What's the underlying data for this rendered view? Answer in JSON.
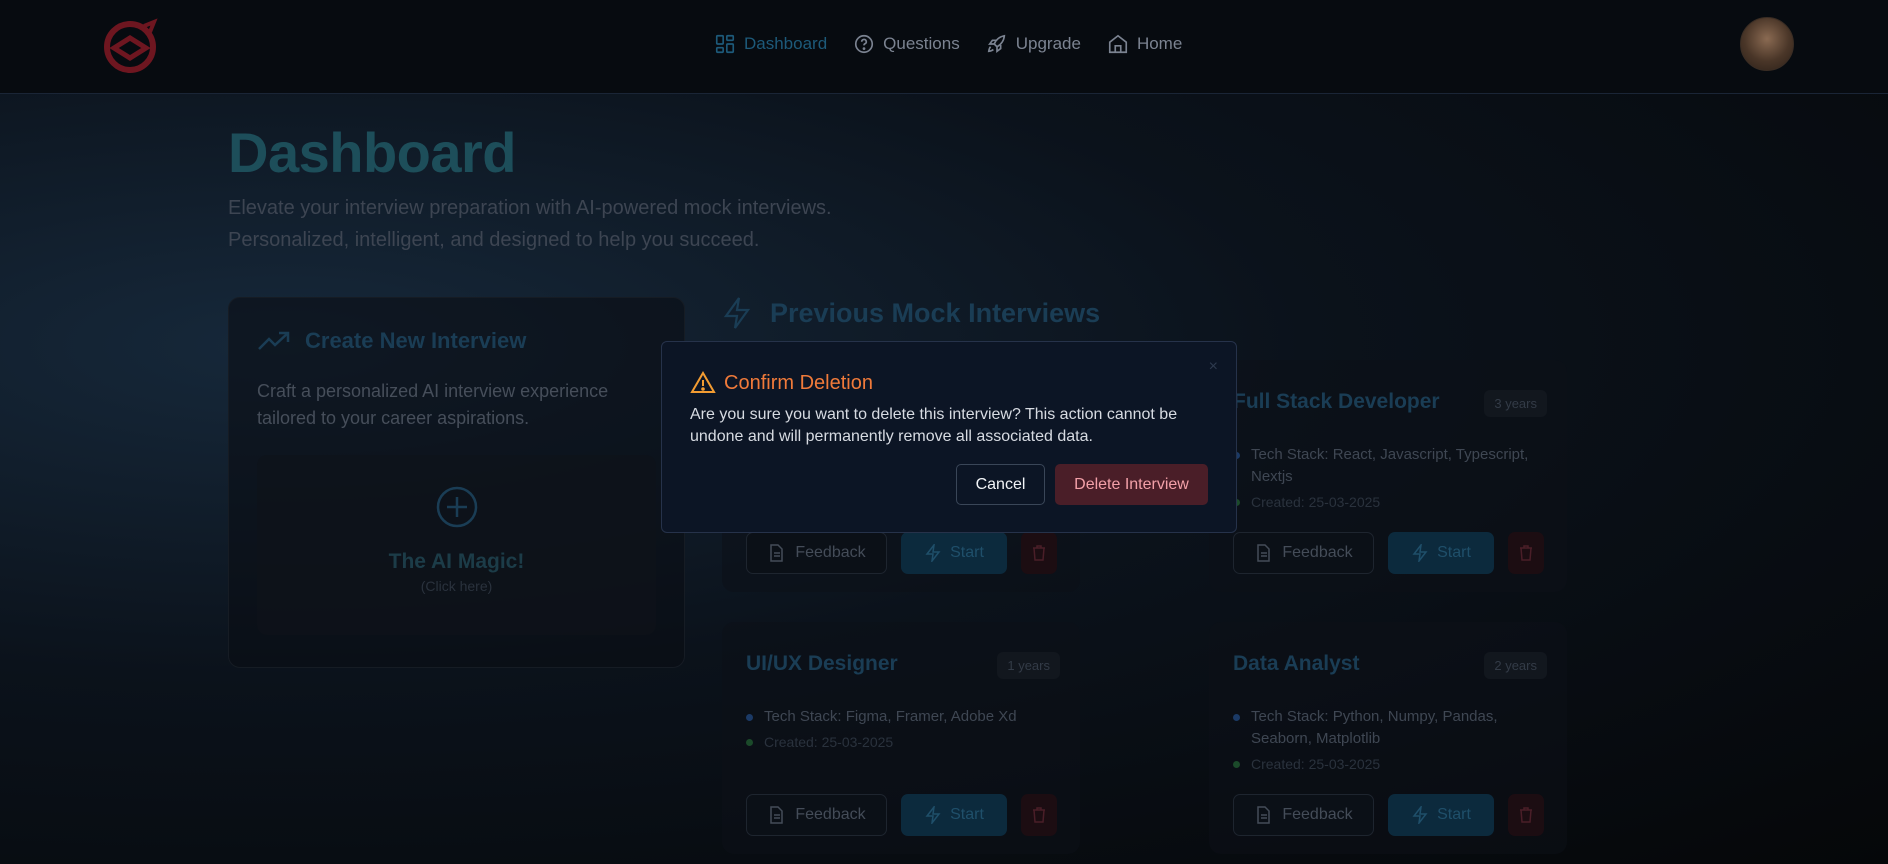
{
  "nav": {
    "links": [
      {
        "label": "Dashboard",
        "icon": "grid-icon",
        "active": true
      },
      {
        "label": "Questions",
        "icon": "question-circle-icon",
        "active": false
      },
      {
        "label": "Upgrade",
        "icon": "rocket-icon",
        "active": false
      },
      {
        "label": "Home",
        "icon": "home-icon",
        "active": false
      }
    ]
  },
  "header": {
    "title": "Dashboard",
    "subtitle_line1": "Elevate your interview preparation with AI-powered mock interviews.",
    "subtitle_line2": "Personalized, intelligent, and designed to help you succeed."
  },
  "create": {
    "title": "Create New Interview",
    "description": "Craft a personalized AI interview experience tailored to your career aspirations.",
    "magic_title": "The AI Magic!",
    "magic_sub": "(Click here)"
  },
  "previous": {
    "title": "Previous Mock Interviews",
    "cards": [
      {
        "title": "",
        "badge": "",
        "stack": "",
        "created": ""
      },
      {
        "title": "Full Stack Developer",
        "badge": "3 years",
        "stack": "Tech Stack: React, Javascript, Typescript, Nextjs",
        "created": "Created: 25-03-2025"
      },
      {
        "title": "UI/UX Designer",
        "badge": "1 years",
        "stack": "Tech Stack: Figma, Framer, Adobe Xd",
        "created": "Created: 25-03-2025"
      },
      {
        "title": "Data Analyst",
        "badge": "2 years",
        "stack": "Tech Stack: Python, Numpy, Pandas, Seaborn, Matplotlib",
        "created": "Created: 25-03-2025"
      }
    ],
    "feedback_label": "Feedback",
    "start_label": "Start"
  },
  "modal": {
    "title": "Confirm Deletion",
    "body": "Are you sure you want to delete this interview? This action cannot be undone and will permanently remove all associated data.",
    "close_glyph": "×",
    "cancel_label": "Cancel",
    "delete_label": "Delete Interview"
  },
  "colors": {
    "accent": "#1d5a7a",
    "warning": "#f39c32",
    "danger_bg": "#4a1e28"
  }
}
